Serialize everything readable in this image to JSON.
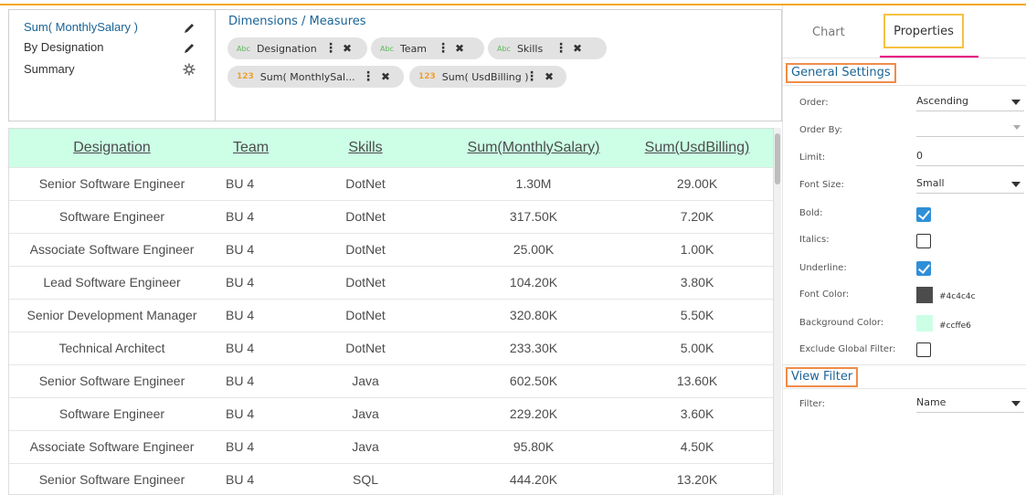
{
  "measures": {
    "items": [
      {
        "label": "Sum( MonthlySalary )",
        "icon": "pencil-icon"
      },
      {
        "label": "By Designation",
        "icon": "pencil-icon"
      },
      {
        "label": "Summary",
        "icon": "gear-icon"
      }
    ]
  },
  "dimensions": {
    "title": "Dimensions / Measures",
    "chips": [
      {
        "tag": "Abc",
        "label": "Designation"
      },
      {
        "tag": "Abc",
        "label": "Team"
      },
      {
        "tag": "Abc",
        "label": "Skills"
      },
      {
        "tag": "123",
        "label": "Sum( MonthlySal..."
      },
      {
        "tag": "123",
        "label": "Sum( UsdBilling )"
      }
    ]
  },
  "table": {
    "headers": [
      "Designation",
      "Team",
      "Skills",
      "Sum(MonthlySalary)",
      "Sum(UsdBilling)"
    ],
    "rows": [
      [
        "Senior Software Engineer",
        "BU 4",
        "DotNet",
        "1.30M",
        "29.00K"
      ],
      [
        "Software Engineer",
        "BU 4",
        "DotNet",
        "317.50K",
        "7.20K"
      ],
      [
        "Associate Software Engineer",
        "BU 4",
        "DotNet",
        "25.00K",
        "1.00K"
      ],
      [
        "Lead Software Engineer",
        "BU 4",
        "DotNet",
        "104.20K",
        "3.80K"
      ],
      [
        "Senior Development Manager",
        "BU 4",
        "DotNet",
        "320.80K",
        "5.50K"
      ],
      [
        "Technical Architect",
        "BU 4",
        "DotNet",
        "233.30K",
        "5.00K"
      ],
      [
        "Senior Software Engineer",
        "BU 4",
        "Java",
        "602.50K",
        "13.60K"
      ],
      [
        "Software Engineer",
        "BU 4",
        "Java",
        "229.20K",
        "3.60K"
      ],
      [
        "Associate Software Engineer",
        "BU 4",
        "Java",
        "95.80K",
        "4.50K"
      ],
      [
        "Senior Software Engineer",
        "BU 4",
        "SQL",
        "444.20K",
        "13.20K"
      ]
    ]
  },
  "panel": {
    "tabs": {
      "chart": "Chart",
      "properties": "Properties"
    },
    "general_settings": "General Settings",
    "order_label": "Order:",
    "order_value": "Ascending",
    "order_by_label": "Order By:",
    "order_by_value": "",
    "limit_label": "Limit:",
    "limit_value": "0",
    "font_size_label": "Font Size:",
    "font_size_value": "Small",
    "bold_label": "Bold:",
    "bold_checked": true,
    "italics_label": "Italics:",
    "italics_checked": false,
    "underline_label": "Underline:",
    "underline_checked": true,
    "font_color_label": "Font Color:",
    "font_color_value": "#4c4c4c",
    "bg_color_label": "Background Color:",
    "bg_color_value": "#ccffe6",
    "exclude_label": "Exclude Global Filter:",
    "exclude_checked": false,
    "view_filter": "View Filter",
    "filter_label": "Filter:",
    "filter_value": "Name"
  },
  "colors": {
    "accent": "#1a6496",
    "header_bg": "#ccffe6",
    "highlight_orange": "#f08c4a",
    "highlight_yellow": "#f5c242",
    "tab_underline": "#e6007e"
  }
}
